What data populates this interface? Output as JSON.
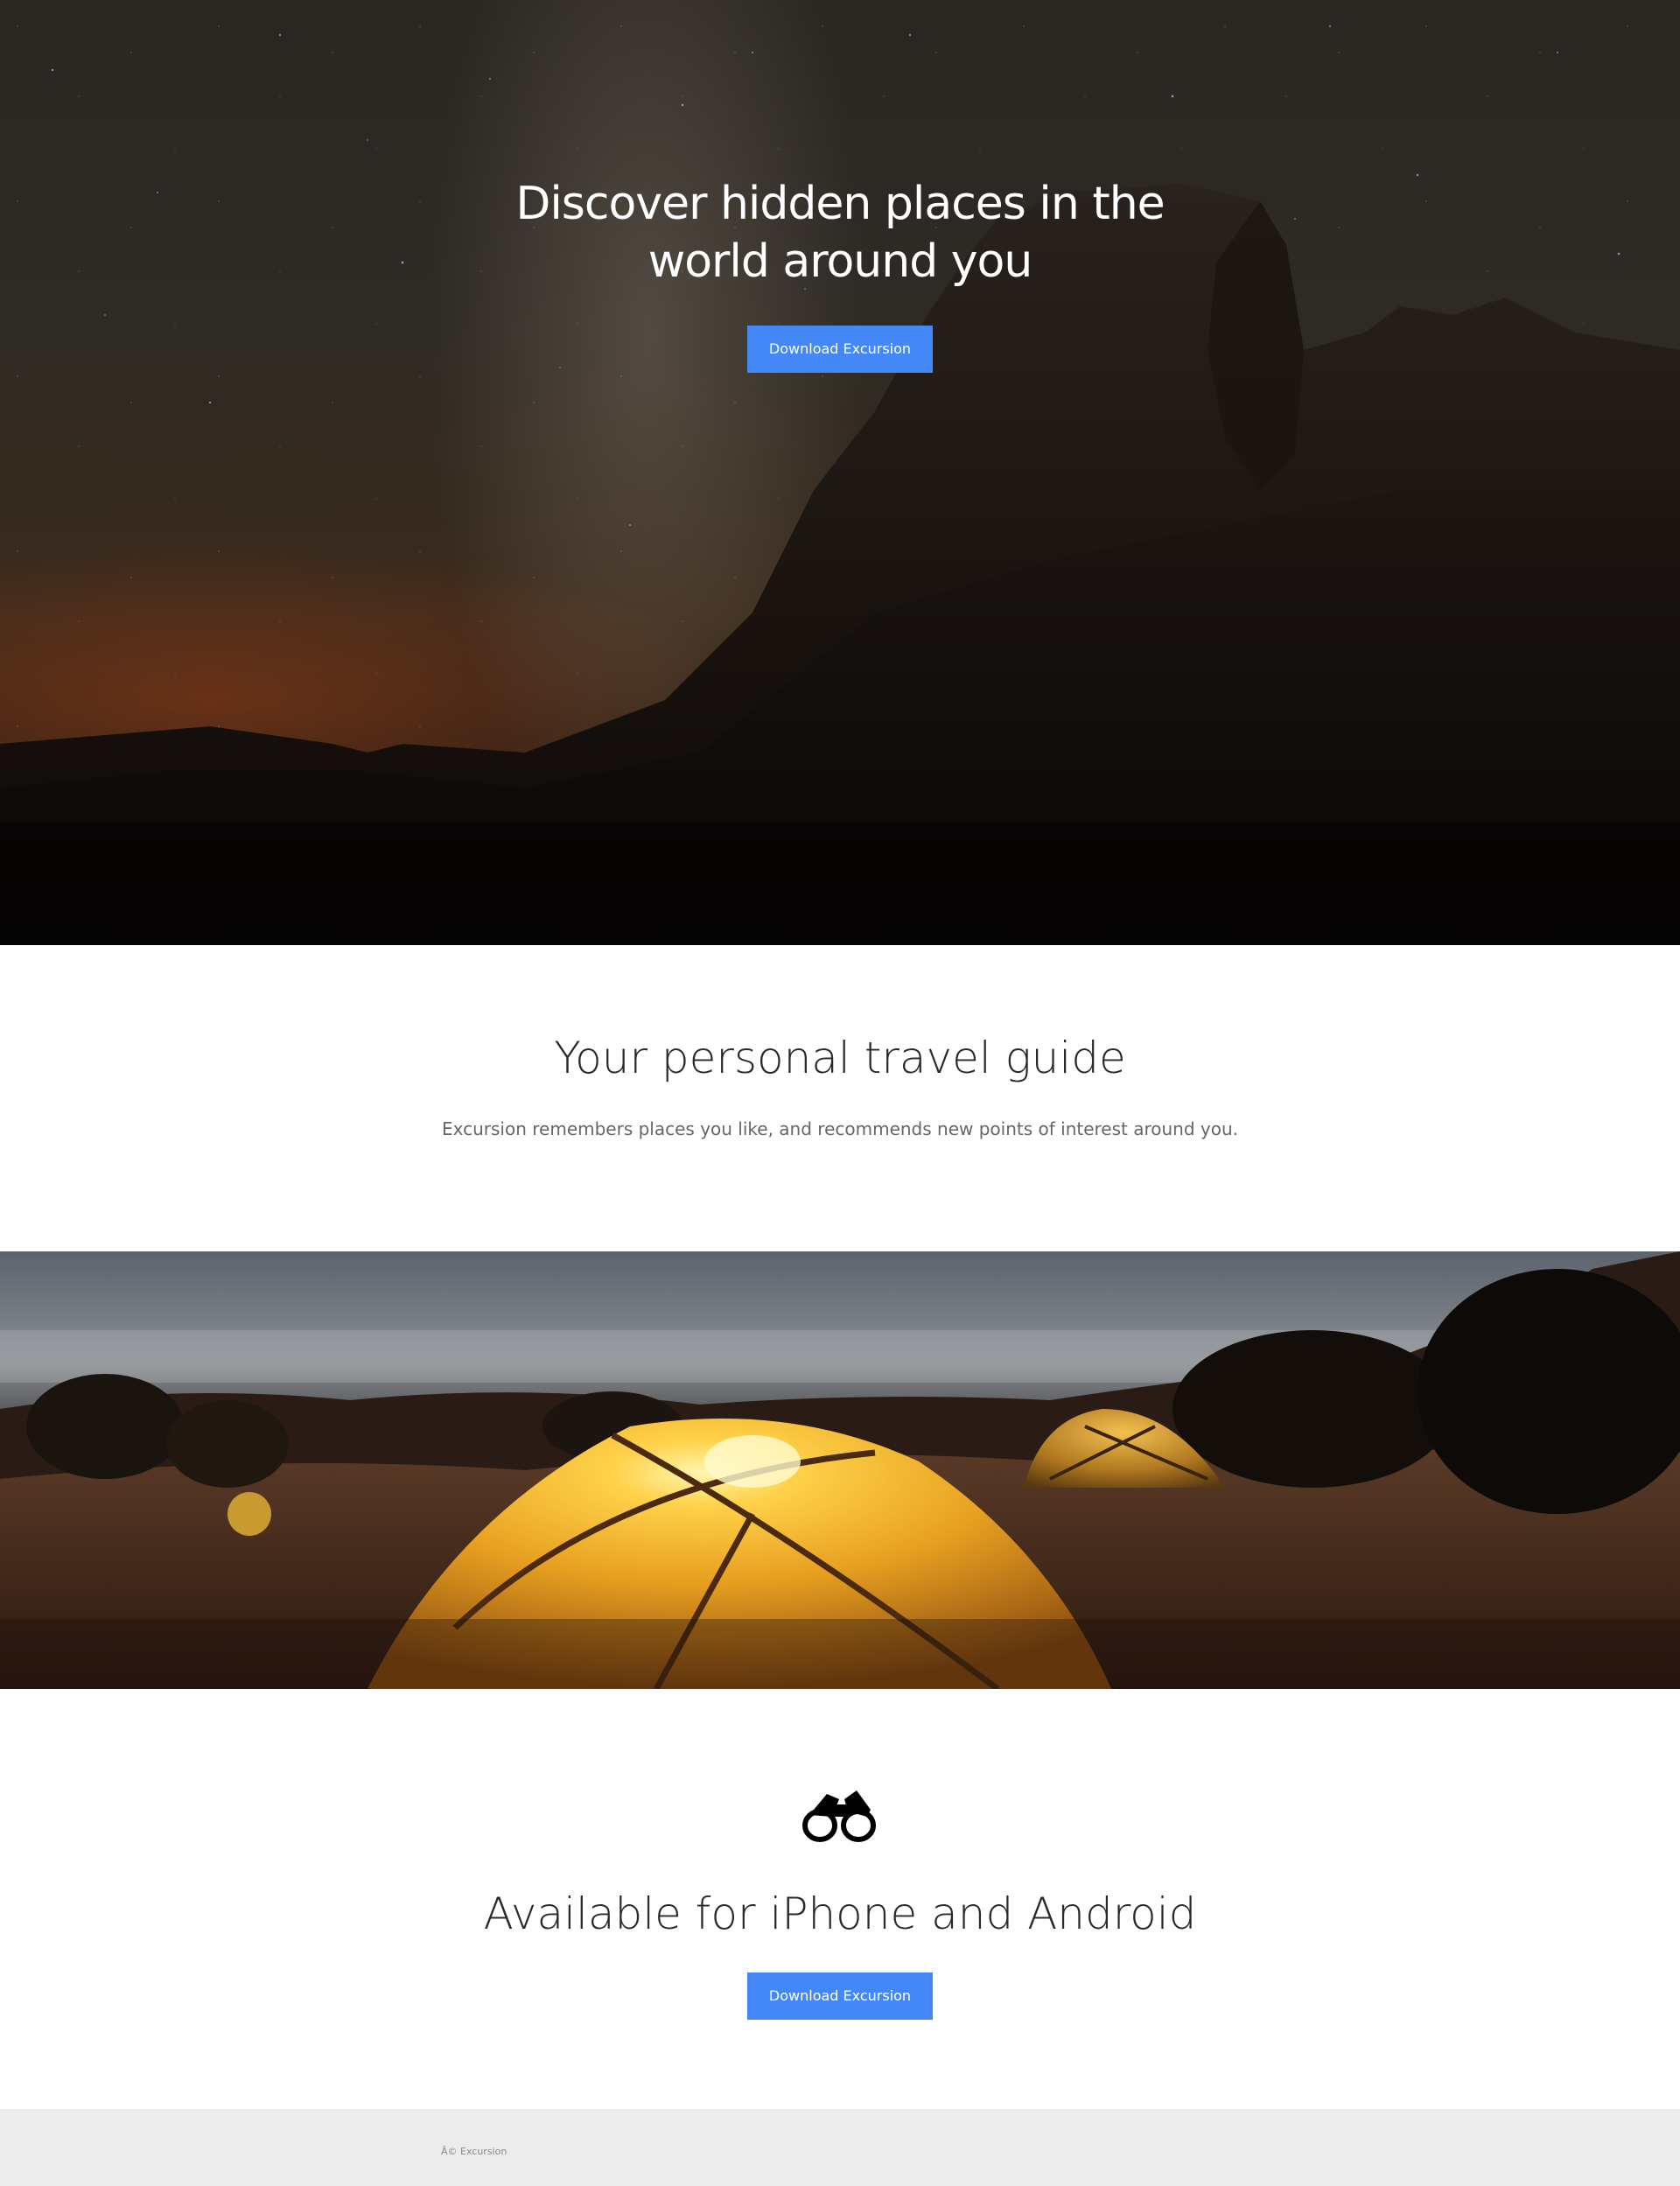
{
  "hero": {
    "title": "Discover hidden places in the world around you",
    "button_label": "Download Excursion"
  },
  "guide": {
    "title": "Your personal travel guide",
    "text": "Excursion remembers places you like, and recommends new points of interest around you."
  },
  "camp_image": {
    "alt": ""
  },
  "available": {
    "icon": "binoculars-icon",
    "title": "Available for iPhone and Android",
    "button_label": "Download Excursion"
  },
  "footer": {
    "copyright": "Â© Excursion"
  },
  "colors": {
    "accent": "#4488f7",
    "footer_bg": "#ececec",
    "title_text": "#2a2a2a",
    "body_text": "#666666"
  }
}
